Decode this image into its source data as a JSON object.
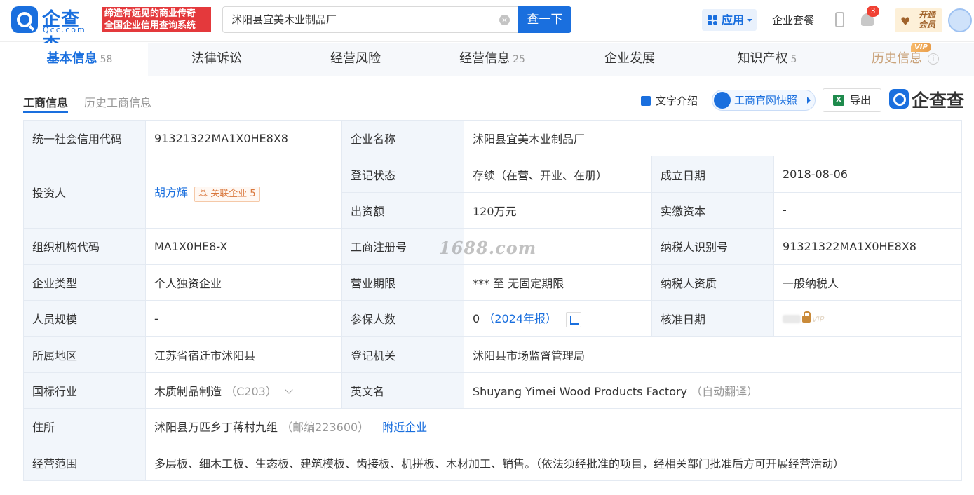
{
  "header": {
    "logo_name": "企查查",
    "logo_sub": "Qcc.com",
    "slogan_line1": "缔造有远见的商业传奇",
    "slogan_line2": "全国企业信用查询系统",
    "search_value": "沭阳县宜美木业制品厂",
    "search_button": "查一下",
    "app_label": "应用",
    "package_label": "企业套餐",
    "notification_count": "3",
    "vip_line1": "开通",
    "vip_line2": "会员"
  },
  "tabs": [
    {
      "label": "基本信息",
      "count": "58",
      "active": true
    },
    {
      "label": "法律诉讼",
      "count": ""
    },
    {
      "label": "经营风险",
      "count": ""
    },
    {
      "label": "经营信息",
      "count": "25"
    },
    {
      "label": "企业发展",
      "count": ""
    },
    {
      "label": "知识产权",
      "count": "5"
    },
    {
      "label": "历史信息",
      "count": "",
      "vip": true
    }
  ],
  "vip_tag": "VIP",
  "section": {
    "subtab_active": "工商信息",
    "subtab_inactive": "历史工商信息",
    "tool_text": "文字介绍",
    "tool_snapshot": "工商官网快照",
    "tool_export": "导出",
    "brand": "企查查"
  },
  "table": {
    "credit_code_label": "统一社会信用代码",
    "credit_code": "91321322MA1X0HE8X8",
    "name_label": "企业名称",
    "name": "沭阳县宜美木业制品厂",
    "investor_label": "投资人",
    "investor": "胡方辉",
    "related_label": "关联企业",
    "related_count": "5",
    "status_label": "登记状态",
    "status": "存续（在营、开业、在册）",
    "founded_label": "成立日期",
    "founded": "2018-08-06",
    "capital_label": "出资额",
    "capital": "120万元",
    "paid_capital_label": "实缴资本",
    "paid_capital": "-",
    "org_code_label": "组织机构代码",
    "org_code": "MA1X0HE8-X",
    "reg_no_label": "工商注册号",
    "reg_no": "",
    "taxpayer_id_label": "纳税人识别号",
    "taxpayer_id": "91321322MA1X0HE8X8",
    "type_label": "企业类型",
    "type": "个人独资企业",
    "term_label": "营业期限",
    "term": "*** 至 无固定期限",
    "tax_qual_label": "纳税人资质",
    "tax_qual": "一般纳税人",
    "staff_label": "人员规模",
    "staff": "-",
    "insured_label": "参保人数",
    "insured": "0",
    "insured_year": "（2024年报）",
    "approve_label": "核准日期",
    "approve_vip": "VIP",
    "region_label": "所属地区",
    "region": "江苏省宿迁市沭阳县",
    "authority_label": "登记机关",
    "authority": "沭阳县市场监督管理局",
    "industry_label": "国标行业",
    "industry": "木质制品制造",
    "industry_code": "（C203）",
    "english_label": "英文名",
    "english": "Shuyang Yimei Wood Products Factory",
    "english_note": "（自动翻译）",
    "address_label": "住所",
    "address": "沭阳县万匹乡丁蒋村九组",
    "postcode": "（邮编223600）",
    "nearby": "附近企业",
    "scope_label": "经营范围",
    "scope": "多层板、细木工板、生态板、建筑模板、齿接板、机拼板、木材加工、销售。（依法须经批准的项目，经相关部门批准后方可开展经营活动）"
  },
  "watermark": "1688.com"
}
